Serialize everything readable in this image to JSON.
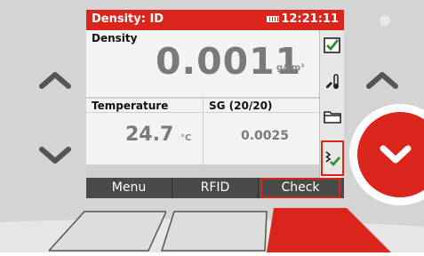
{
  "titlebar": {
    "title": "Density: ID",
    "clock": "12:21:11",
    "battery_icon": "battery-icon"
  },
  "main": {
    "label": "Density",
    "value": "0.0011",
    "unit": "g/cm³"
  },
  "temperature": {
    "label": "Temperature",
    "value": "24.7",
    "unit": "°C"
  },
  "sg": {
    "label": "SG (20/20)",
    "value": "0.0025"
  },
  "sidebar": {
    "icons": [
      "checkbox-check-icon",
      "temperature-edit-icon",
      "folder-icon",
      "check-list-icon"
    ]
  },
  "softkeys": {
    "menu": "Menu",
    "rfid": "RFID",
    "check": "Check"
  },
  "colors": {
    "accent_red": "#d9251c",
    "device_body": "#d3d3d3",
    "screen_bg": "#f4f3f3",
    "softkey_bg": "#4a4a4a"
  }
}
